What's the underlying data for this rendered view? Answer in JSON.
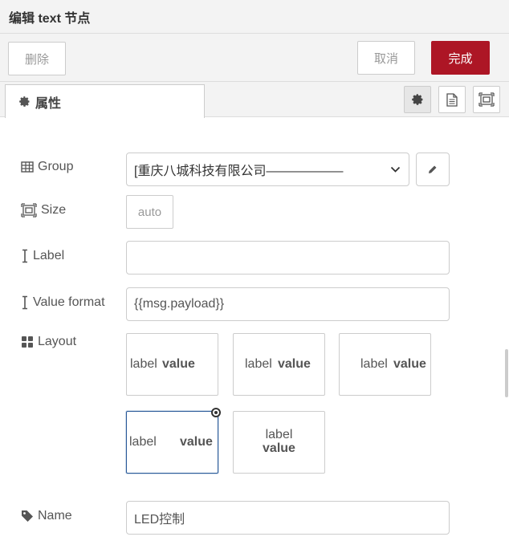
{
  "title": "编辑 text 节点",
  "buttons": {
    "delete": "删除",
    "cancel": "取消",
    "done": "完成"
  },
  "tab": {
    "label": "属性"
  },
  "tray_icons": [
    "gear-icon",
    "description-icon",
    "appearance-icon"
  ],
  "form": {
    "group": {
      "label": "Group",
      "value": "[重庆八城科技有限公司——————"
    },
    "size": {
      "label": "Size",
      "value": "auto"
    },
    "label": {
      "label": "Label",
      "value": ""
    },
    "value_format": {
      "label": "Value format",
      "value": "{{msg.payload}}"
    },
    "layout": {
      "label": "Layout",
      "options": [
        {
          "label": "label",
          "value": "value"
        },
        {
          "label": "label",
          "value": "value"
        },
        {
          "label": "label",
          "value": "value"
        },
        {
          "label": "label",
          "value": "value"
        },
        {
          "label": "label",
          "value": "value"
        }
      ],
      "selected_index": 3
    },
    "name": {
      "label": "Name",
      "value": "LED控制"
    }
  },
  "colors": {
    "primary": "#ad1625",
    "selected_border": "#2a5a99"
  }
}
